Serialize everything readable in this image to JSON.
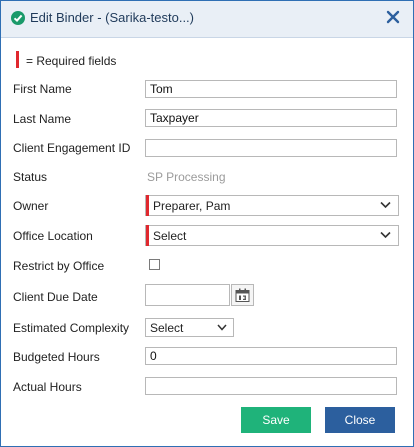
{
  "dialog": {
    "title": "Edit Binder - (Sarika-testo...)",
    "required_note": "= Required fields"
  },
  "form": {
    "first_name": {
      "label": "First Name",
      "value": "Tom"
    },
    "last_name": {
      "label": "Last Name",
      "value": "Taxpayer"
    },
    "engagement_id": {
      "label": "Client Engagement ID",
      "value": ""
    },
    "status": {
      "label": "Status",
      "value": "SP Processing"
    },
    "owner": {
      "label": "Owner",
      "value": "Preparer, Pam"
    },
    "office_location": {
      "label": "Office Location",
      "value": "Select"
    },
    "restrict_by_office": {
      "label": "Restrict by Office",
      "checked": false
    },
    "client_due_date": {
      "label": "Client Due Date",
      "value": ""
    },
    "estimated_complexity": {
      "label": "Estimated Complexity",
      "value": "Select"
    },
    "budgeted_hours": {
      "label": "Budgeted Hours",
      "value": "0"
    },
    "actual_hours": {
      "label": "Actual Hours",
      "value": ""
    }
  },
  "buttons": {
    "save": "Save",
    "close": "Close"
  },
  "colors": {
    "required": "#e0282e",
    "save": "#1fb37a",
    "close": "#2c5f9e",
    "title": "#1f3a5a"
  },
  "icons": {
    "title": "check-circle-icon",
    "close": "close-icon",
    "calendar": "calendar-icon",
    "chevron": "chevron-down-icon"
  }
}
